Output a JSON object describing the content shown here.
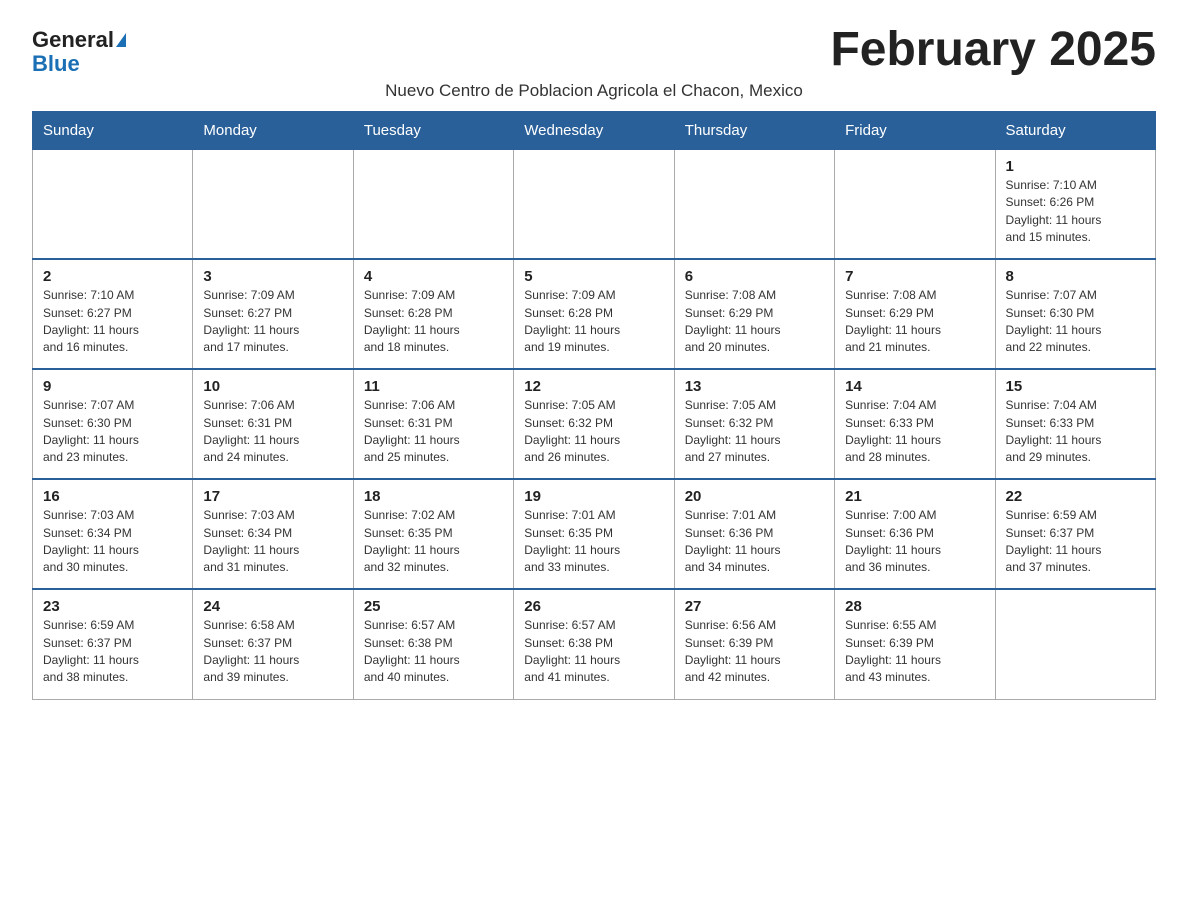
{
  "header": {
    "logo_general": "General",
    "logo_blue": "Blue",
    "month_title": "February 2025",
    "subtitle": "Nuevo Centro de Poblacion Agricola el Chacon, Mexico"
  },
  "weekdays": [
    "Sunday",
    "Monday",
    "Tuesday",
    "Wednesday",
    "Thursday",
    "Friday",
    "Saturday"
  ],
  "weeks": [
    [
      {
        "day": "",
        "info": ""
      },
      {
        "day": "",
        "info": ""
      },
      {
        "day": "",
        "info": ""
      },
      {
        "day": "",
        "info": ""
      },
      {
        "day": "",
        "info": ""
      },
      {
        "day": "",
        "info": ""
      },
      {
        "day": "1",
        "info": "Sunrise: 7:10 AM\nSunset: 6:26 PM\nDaylight: 11 hours\nand 15 minutes."
      }
    ],
    [
      {
        "day": "2",
        "info": "Sunrise: 7:10 AM\nSunset: 6:27 PM\nDaylight: 11 hours\nand 16 minutes."
      },
      {
        "day": "3",
        "info": "Sunrise: 7:09 AM\nSunset: 6:27 PM\nDaylight: 11 hours\nand 17 minutes."
      },
      {
        "day": "4",
        "info": "Sunrise: 7:09 AM\nSunset: 6:28 PM\nDaylight: 11 hours\nand 18 minutes."
      },
      {
        "day": "5",
        "info": "Sunrise: 7:09 AM\nSunset: 6:28 PM\nDaylight: 11 hours\nand 19 minutes."
      },
      {
        "day": "6",
        "info": "Sunrise: 7:08 AM\nSunset: 6:29 PM\nDaylight: 11 hours\nand 20 minutes."
      },
      {
        "day": "7",
        "info": "Sunrise: 7:08 AM\nSunset: 6:29 PM\nDaylight: 11 hours\nand 21 minutes."
      },
      {
        "day": "8",
        "info": "Sunrise: 7:07 AM\nSunset: 6:30 PM\nDaylight: 11 hours\nand 22 minutes."
      }
    ],
    [
      {
        "day": "9",
        "info": "Sunrise: 7:07 AM\nSunset: 6:30 PM\nDaylight: 11 hours\nand 23 minutes."
      },
      {
        "day": "10",
        "info": "Sunrise: 7:06 AM\nSunset: 6:31 PM\nDaylight: 11 hours\nand 24 minutes."
      },
      {
        "day": "11",
        "info": "Sunrise: 7:06 AM\nSunset: 6:31 PM\nDaylight: 11 hours\nand 25 minutes."
      },
      {
        "day": "12",
        "info": "Sunrise: 7:05 AM\nSunset: 6:32 PM\nDaylight: 11 hours\nand 26 minutes."
      },
      {
        "day": "13",
        "info": "Sunrise: 7:05 AM\nSunset: 6:32 PM\nDaylight: 11 hours\nand 27 minutes."
      },
      {
        "day": "14",
        "info": "Sunrise: 7:04 AM\nSunset: 6:33 PM\nDaylight: 11 hours\nand 28 minutes."
      },
      {
        "day": "15",
        "info": "Sunrise: 7:04 AM\nSunset: 6:33 PM\nDaylight: 11 hours\nand 29 minutes."
      }
    ],
    [
      {
        "day": "16",
        "info": "Sunrise: 7:03 AM\nSunset: 6:34 PM\nDaylight: 11 hours\nand 30 minutes."
      },
      {
        "day": "17",
        "info": "Sunrise: 7:03 AM\nSunset: 6:34 PM\nDaylight: 11 hours\nand 31 minutes."
      },
      {
        "day": "18",
        "info": "Sunrise: 7:02 AM\nSunset: 6:35 PM\nDaylight: 11 hours\nand 32 minutes."
      },
      {
        "day": "19",
        "info": "Sunrise: 7:01 AM\nSunset: 6:35 PM\nDaylight: 11 hours\nand 33 minutes."
      },
      {
        "day": "20",
        "info": "Sunrise: 7:01 AM\nSunset: 6:36 PM\nDaylight: 11 hours\nand 34 minutes."
      },
      {
        "day": "21",
        "info": "Sunrise: 7:00 AM\nSunset: 6:36 PM\nDaylight: 11 hours\nand 36 minutes."
      },
      {
        "day": "22",
        "info": "Sunrise: 6:59 AM\nSunset: 6:37 PM\nDaylight: 11 hours\nand 37 minutes."
      }
    ],
    [
      {
        "day": "23",
        "info": "Sunrise: 6:59 AM\nSunset: 6:37 PM\nDaylight: 11 hours\nand 38 minutes."
      },
      {
        "day": "24",
        "info": "Sunrise: 6:58 AM\nSunset: 6:37 PM\nDaylight: 11 hours\nand 39 minutes."
      },
      {
        "day": "25",
        "info": "Sunrise: 6:57 AM\nSunset: 6:38 PM\nDaylight: 11 hours\nand 40 minutes."
      },
      {
        "day": "26",
        "info": "Sunrise: 6:57 AM\nSunset: 6:38 PM\nDaylight: 11 hours\nand 41 minutes."
      },
      {
        "day": "27",
        "info": "Sunrise: 6:56 AM\nSunset: 6:39 PM\nDaylight: 11 hours\nand 42 minutes."
      },
      {
        "day": "28",
        "info": "Sunrise: 6:55 AM\nSunset: 6:39 PM\nDaylight: 11 hours\nand 43 minutes."
      },
      {
        "day": "",
        "info": ""
      }
    ]
  ]
}
